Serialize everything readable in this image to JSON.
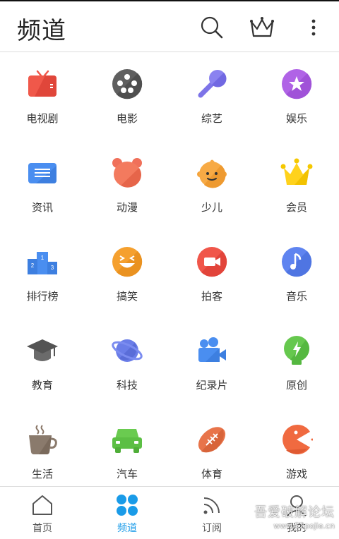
{
  "header": {
    "title": "频道"
  },
  "channels": [
    {
      "label": "电视剧",
      "icon": "tv-icon"
    },
    {
      "label": "电影",
      "icon": "film-reel-icon"
    },
    {
      "label": "综艺",
      "icon": "microphone-icon"
    },
    {
      "label": "娱乐",
      "icon": "star-icon"
    },
    {
      "label": "资讯",
      "icon": "news-icon"
    },
    {
      "label": "动漫",
      "icon": "bear-icon"
    },
    {
      "label": "少儿",
      "icon": "kid-face-icon"
    },
    {
      "label": "会员",
      "icon": "crown-icon"
    },
    {
      "label": "排行榜",
      "icon": "podium-icon"
    },
    {
      "label": "搞笑",
      "icon": "laugh-face-icon"
    },
    {
      "label": "拍客",
      "icon": "video-camera-icon"
    },
    {
      "label": "音乐",
      "icon": "music-note-icon"
    },
    {
      "label": "教育",
      "icon": "graduation-cap-icon"
    },
    {
      "label": "科技",
      "icon": "planet-icon"
    },
    {
      "label": "纪录片",
      "icon": "camera-icon"
    },
    {
      "label": "原创",
      "icon": "lightbulb-icon"
    },
    {
      "label": "生活",
      "icon": "coffee-cup-icon"
    },
    {
      "label": "汽车",
      "icon": "car-icon"
    },
    {
      "label": "体育",
      "icon": "football-icon"
    },
    {
      "label": "游戏",
      "icon": "pacman-icon"
    }
  ],
  "tabbar": {
    "tabs": [
      {
        "label": "首页",
        "icon": "home-icon"
      },
      {
        "label": "频道",
        "icon": "channel-dots-icon"
      },
      {
        "label": "订阅",
        "icon": "rss-icon"
      },
      {
        "label": "我的",
        "icon": "user-icon"
      }
    ],
    "active_color": "#1a9be8"
  },
  "watermark": {
    "line1": "吾爱破解论坛",
    "line2": "www.52pojie.cn"
  }
}
